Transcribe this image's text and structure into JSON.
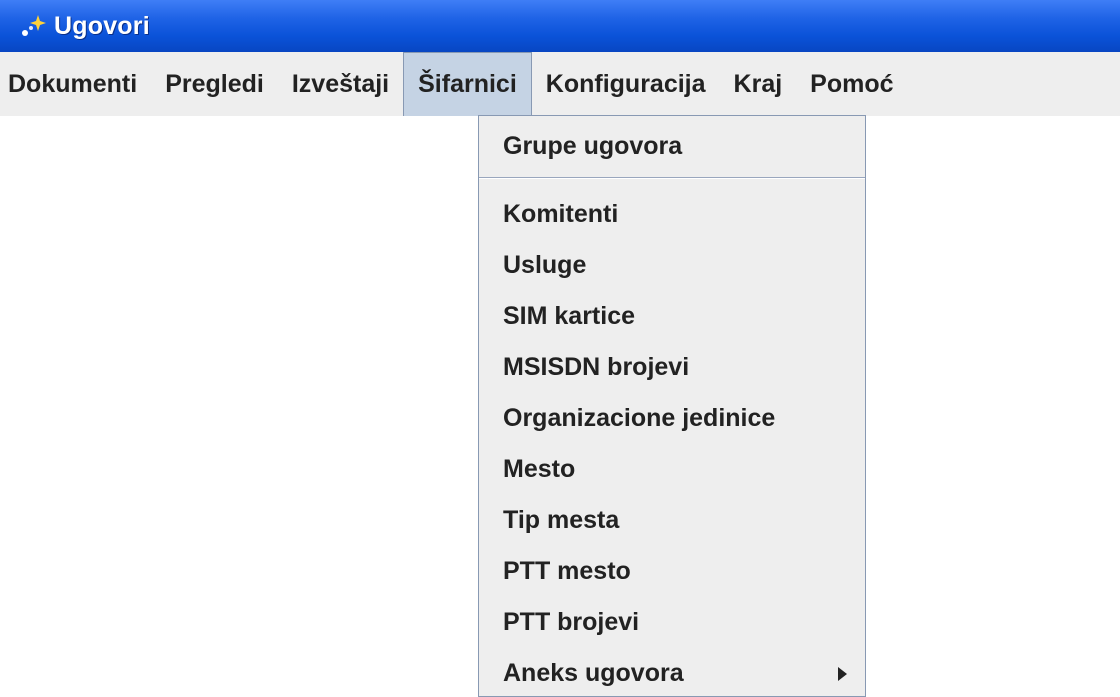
{
  "window": {
    "title": "Ugovori",
    "title_icon": "app-sparkle-icon"
  },
  "menubar": {
    "items": [
      {
        "label": "Dokumenti"
      },
      {
        "label": "Pregledi"
      },
      {
        "label": "Izveštaji"
      },
      {
        "label": "Šifarnici",
        "active": true
      },
      {
        "label": "Konfiguracija"
      },
      {
        "label": "Kraj"
      },
      {
        "label": "Pomoć"
      }
    ]
  },
  "dropdown": {
    "parent": "Šifarnici",
    "items": [
      {
        "label": "Grupe ugovora"
      },
      {
        "label": "Komitenti"
      },
      {
        "label": "Usluge"
      },
      {
        "label": "SIM kartice"
      },
      {
        "label": "MSISDN brojevi"
      },
      {
        "label": "Organizacione jedinice"
      },
      {
        "label": "Mesto"
      },
      {
        "label": "Tip mesta"
      },
      {
        "label": "PTT mesto"
      },
      {
        "label": "PTT brojevi"
      },
      {
        "label": "Aneks ugovora",
        "has_submenu": true,
        "submenu_icon": "chevron-right-icon"
      }
    ]
  },
  "colors": {
    "titlebar": "#0a52d8",
    "menubar_bg": "#eeeeee",
    "active_menu_bg": "#c5d3e4",
    "border": "#8899b3"
  }
}
